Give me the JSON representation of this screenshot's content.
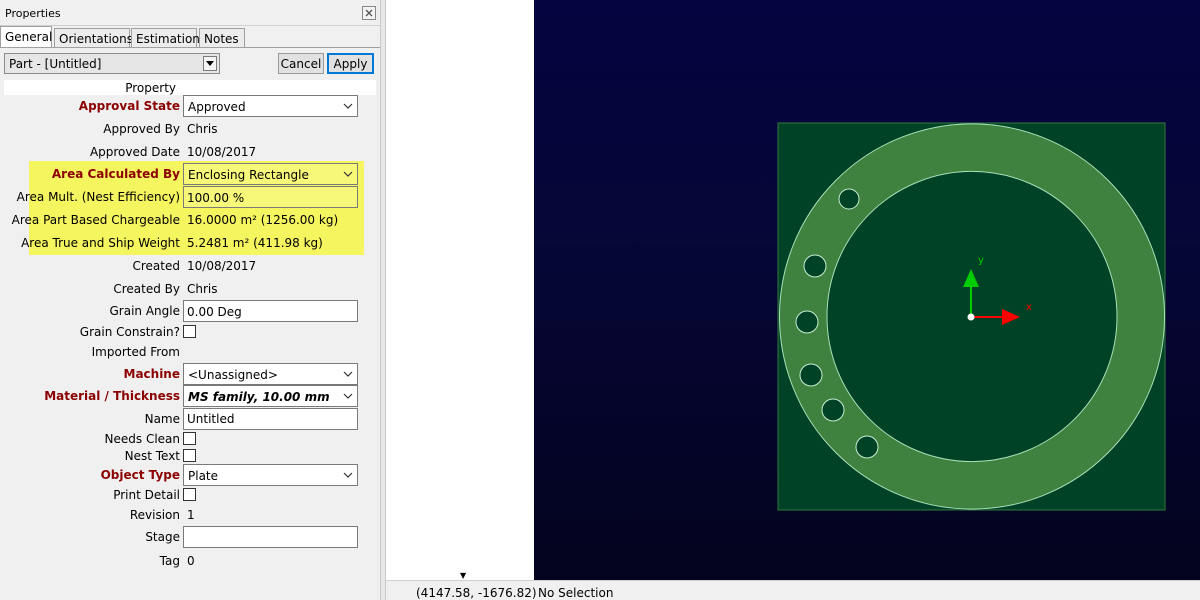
{
  "panel": {
    "title": "Properties",
    "tabs": [
      "General",
      "Orientations",
      "Estimation",
      "Notes"
    ],
    "part_select": "Part - [Untitled]",
    "cancel_label": "Cancel",
    "apply_label": "Apply",
    "header_label": "Property"
  },
  "props": {
    "approval_state": {
      "label": "Approval State",
      "value": "Approved"
    },
    "approved_by": {
      "label": "Approved By",
      "value": "Chris"
    },
    "approved_date": {
      "label": "Approved Date",
      "value": "10/08/2017"
    },
    "area_calculated_by": {
      "label": "Area Calculated By",
      "value": "Enclosing Rectangle"
    },
    "area_mult": {
      "label": "Area Mult. (Nest Efficiency)",
      "value": "100.00 %"
    },
    "area_part_based": {
      "label": "Area Part Based Chargeable",
      "value": "16.0000 m² (1256.00 kg)"
    },
    "area_true": {
      "label": "Area True and Ship Weight",
      "value": "5.2481 m² (411.98 kg)"
    },
    "created": {
      "label": "Created",
      "value": "10/08/2017"
    },
    "created_by": {
      "label": "Created By",
      "value": "Chris"
    },
    "grain_angle": {
      "label": "Grain Angle",
      "value": "0.00 Deg"
    },
    "grain_constrain": {
      "label": "Grain Constrain?",
      "checked": false
    },
    "imported_from": {
      "label": "Imported From",
      "value": ""
    },
    "machine": {
      "label": "Machine",
      "value": "<Unassigned>"
    },
    "material_thickness": {
      "label": "Material / Thickness",
      "value": "MS family, 10.00 mm"
    },
    "name": {
      "label": "Name",
      "value": "Untitled"
    },
    "needs_clean": {
      "label": "Needs Clean",
      "checked": false
    },
    "nest_text": {
      "label": "Nest Text",
      "checked": false
    },
    "object_type": {
      "label": "Object Type",
      "value": "Plate"
    },
    "print_detail": {
      "label": "Print Detail",
      "checked": false
    },
    "revision": {
      "label": "Revision",
      "value": "1"
    },
    "stage": {
      "label": "Stage",
      "value": ""
    },
    "tag": {
      "label": "Tag",
      "value": "0"
    }
  },
  "canvas": {
    "axis_x_label": "x",
    "axis_y_label": "y",
    "colors": {
      "background": "#040440",
      "plate": "#004225",
      "ring": "#3f813f",
      "axis_x": "#ff0000",
      "axis_y": "#00cc00"
    }
  },
  "status": {
    "coords": "(4147.58, -1676.82)",
    "selection": "No Selection"
  }
}
